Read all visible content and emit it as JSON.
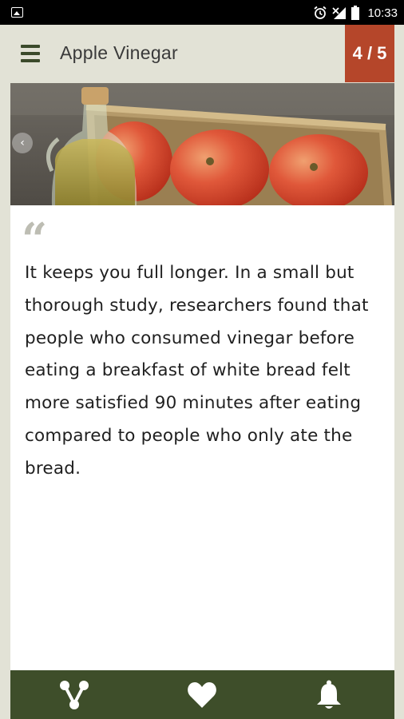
{
  "status_bar": {
    "time": "10:33",
    "left_icon": "image-notification-icon",
    "right_icons": [
      "alarm-icon",
      "no-signal-icon",
      "battery-icon"
    ]
  },
  "app_bar": {
    "menu_icon": "hamburger-menu-icon",
    "title": "Apple Vinegar",
    "page_counter": "4 / 5"
  },
  "card": {
    "hero_image": "apples-in-basket-with-vinegar-bottle",
    "quote_mark": "“",
    "text": "It keeps you full longer. In a small but thorough study, researchers found that people who consumed vinegar before eating a breakfast of white bread felt more satisfied 90 minutes after eating compared to people who only ate the bread."
  },
  "bottom_bar": {
    "buttons": [
      "share-icon",
      "heart-icon",
      "bell-icon"
    ]
  },
  "colors": {
    "accent": "#b5462a",
    "bottom_bar": "#3e4e2a",
    "background": "#e2e2d6"
  }
}
